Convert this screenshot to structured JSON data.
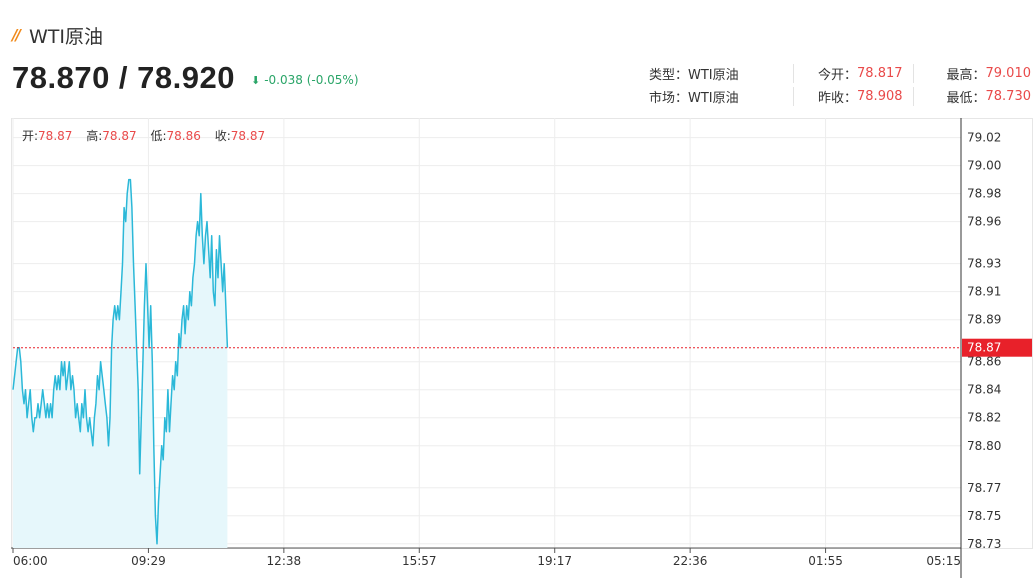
{
  "header": {
    "title": "WTI原油",
    "price_text": "78.870 / 78.920",
    "change_text": "-0.038 (-0.05%)",
    "change_icon": "down-arrow-icon"
  },
  "info": {
    "type_label": "类型：",
    "type_value": "WTI原油",
    "market_label": "市场：",
    "market_value": "WTI原油",
    "open_label": "今开：",
    "open_value": "78.817",
    "prev_close_label": "昨收：",
    "prev_close_value": "78.908",
    "high_label": "最高：",
    "high_value": "79.010",
    "low_label": "最低：",
    "low_value": "78.730"
  },
  "ohlc": {
    "open_label": "开:",
    "open_value": "78.87",
    "high_label": "高:",
    "high_value": "78.87",
    "low_label": "低:",
    "low_value": "78.86",
    "close_label": "收:",
    "close_value": "78.87"
  },
  "colors": {
    "line": "#2bb8d8",
    "fill": "#e6f7fb",
    "current": "#e8212a",
    "up": "#e94a4a",
    "down": "#2aa568",
    "accent": "#f08a1c"
  },
  "chart_data": {
    "type": "area",
    "x_ticks": [
      "06:00",
      "09:29",
      "12:38",
      "15:57",
      "19:17",
      "22:36",
      "01:55",
      "05:15"
    ],
    "y_ticks": [
      "79.02",
      "79.00",
      "78.98",
      "78.96",
      "78.93",
      "78.91",
      "78.89",
      "78.86",
      "78.84",
      "78.82",
      "78.80",
      "78.77",
      "78.75",
      "78.73"
    ],
    "ylim": [
      78.727,
      79.034
    ],
    "current_value": "78.87",
    "series": [
      {
        "x_start": "06:00",
        "x_end": "11:15",
        "values": [
          78.84,
          78.85,
          78.86,
          78.87,
          78.87,
          78.86,
          78.84,
          78.83,
          78.84,
          78.82,
          78.83,
          78.84,
          78.82,
          78.81,
          78.82,
          78.82,
          78.83,
          78.82,
          78.83,
          78.84,
          78.83,
          78.82,
          78.83,
          78.82,
          78.83,
          78.82,
          78.84,
          78.85,
          78.84,
          78.85,
          78.84,
          78.86,
          78.85,
          78.86,
          78.84,
          78.85,
          78.86,
          78.84,
          78.85,
          78.84,
          78.82,
          78.83,
          78.82,
          78.81,
          78.83,
          78.82,
          78.84,
          78.82,
          78.81,
          78.82,
          78.81,
          78.8,
          78.82,
          78.83,
          78.85,
          78.84,
          78.86,
          78.85,
          78.84,
          78.83,
          78.82,
          78.8,
          78.82,
          78.87,
          78.89,
          78.9,
          78.89,
          78.9,
          78.89,
          78.91,
          78.93,
          78.97,
          78.96,
          78.98,
          78.99,
          78.99,
          78.97,
          78.93,
          78.9,
          78.87,
          78.84,
          78.78,
          78.82,
          78.86,
          78.9,
          78.93,
          78.9,
          78.87,
          78.9,
          78.86,
          78.8,
          78.75,
          78.73,
          78.76,
          78.78,
          78.8,
          78.79,
          78.82,
          78.81,
          78.84,
          78.81,
          78.83,
          78.85,
          78.84,
          78.86,
          78.85,
          78.88,
          78.87,
          78.89,
          78.9,
          78.88,
          78.9,
          78.89,
          78.91,
          78.9,
          78.92,
          78.93,
          78.95,
          78.96,
          78.95,
          78.98,
          78.95,
          78.93,
          78.95,
          78.96,
          78.94,
          78.92,
          78.95,
          78.91,
          78.9,
          78.94,
          78.92,
          78.95,
          78.93,
          78.91,
          78.93,
          78.9,
          78.87
        ]
      }
    ]
  }
}
